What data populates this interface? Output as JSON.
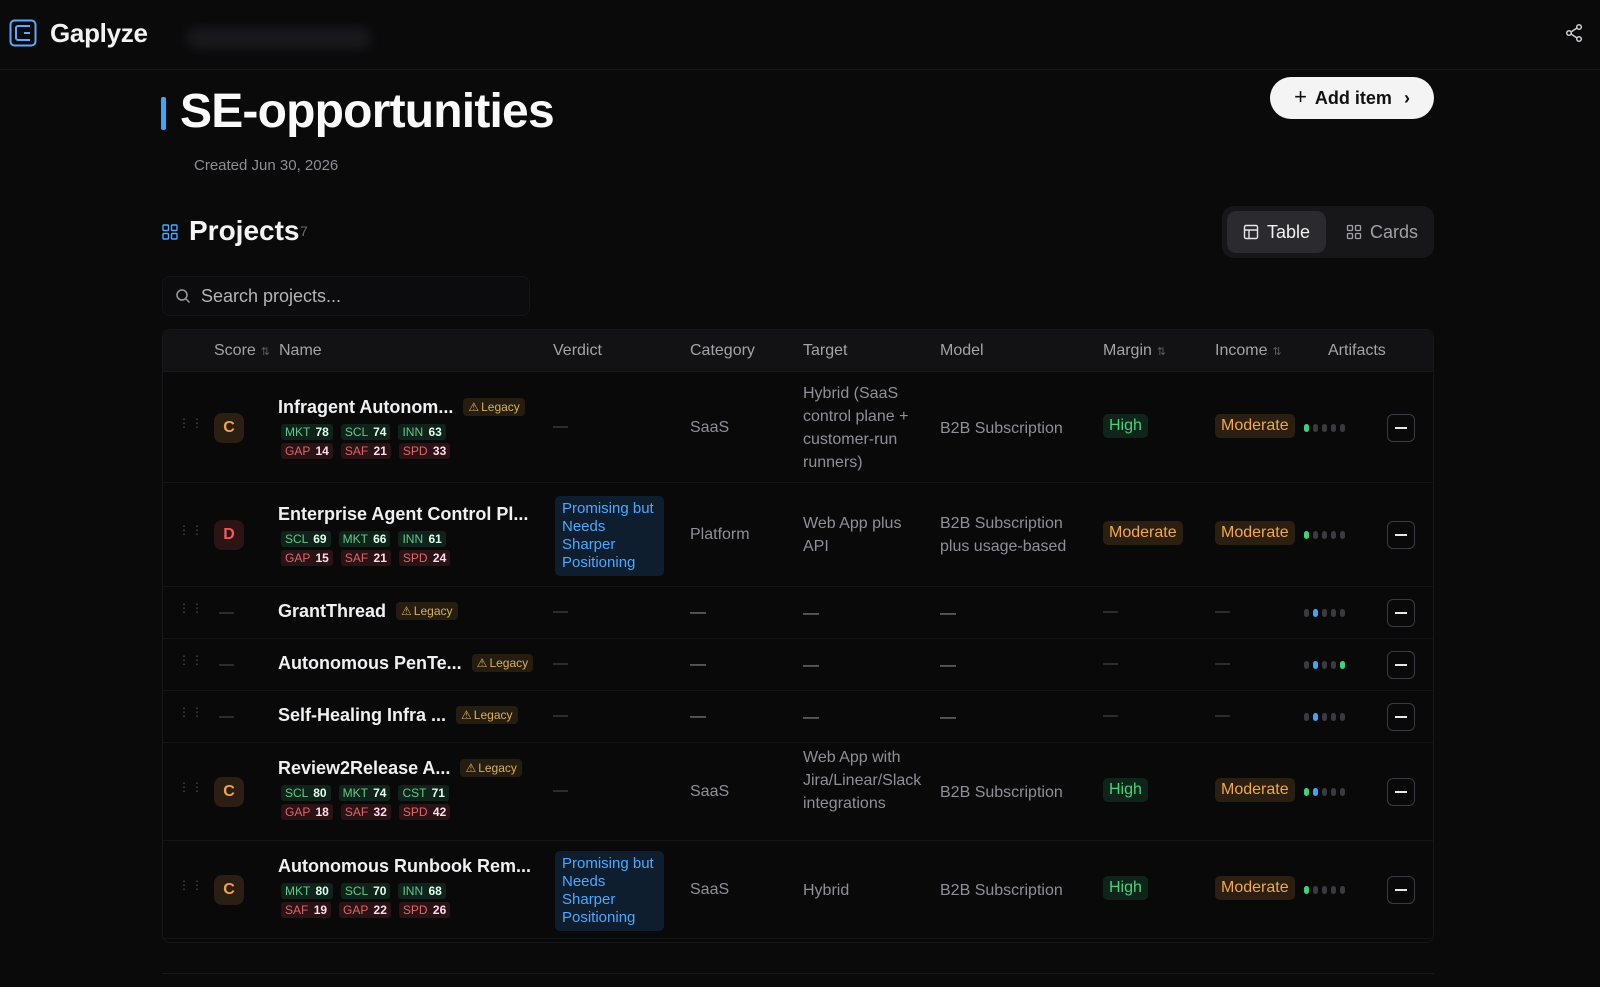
{
  "app": {
    "brand": "Gaplyze"
  },
  "header": {
    "title": "SE-opportunities",
    "created": "Created Jun 30, 2026",
    "add_button": "Add item"
  },
  "projects": {
    "title": "Projects",
    "count": "7",
    "view_table": "Table",
    "view_cards": "Cards",
    "search_placeholder": "Search projects..."
  },
  "columns": {
    "score": "Score",
    "name": "Name",
    "verdict": "Verdict",
    "category": "Category",
    "target": "Target",
    "model": "Model",
    "margin": "Margin",
    "income": "Income",
    "artifacts": "Artifacts"
  },
  "dash": "—",
  "legacy_label": "Legacy",
  "rows": [
    {
      "grade": "C",
      "name": "Infragent Autonom...",
      "legacy": true,
      "metrics_good": [
        [
          "MKT",
          "78"
        ],
        [
          "SCL",
          "74"
        ],
        [
          "INN",
          "63"
        ]
      ],
      "metrics_bad": [
        [
          "GAP",
          "14"
        ],
        [
          "SAF",
          "21"
        ],
        [
          "SPD",
          "33"
        ]
      ],
      "verdict": "—",
      "category": "SaaS",
      "target": "Hybrid (SaaS control plane + customer-run runners)",
      "model": "B2B Subscription",
      "margin": "High",
      "income": "Moderate",
      "artifacts": [
        "green",
        "off",
        "off",
        "off",
        "off"
      ]
    },
    {
      "grade": "D",
      "name": "Enterprise Agent Control Pl...",
      "legacy": false,
      "metrics_good": [
        [
          "SCL",
          "69"
        ],
        [
          "MKT",
          "66"
        ],
        [
          "INN",
          "61"
        ]
      ],
      "metrics_bad": [
        [
          "GAP",
          "15"
        ],
        [
          "SAF",
          "21"
        ],
        [
          "SPD",
          "24"
        ]
      ],
      "verdict": "Promising but Needs Sharper Positioning",
      "category": "Platform",
      "target": "Web App plus API",
      "model": "B2B Subscription plus usage-based",
      "margin": "Moderate",
      "income": "Moderate",
      "artifacts": [
        "green",
        "off",
        "off",
        "off",
        "off"
      ]
    },
    {
      "grade": "—",
      "name": "GrantThread",
      "legacy": true,
      "verdict": "—",
      "category": "—",
      "target": "—",
      "model": "—",
      "margin": "—",
      "income": "—",
      "artifacts": [
        "off",
        "blue",
        "off",
        "off",
        "off"
      ]
    },
    {
      "grade": "—",
      "name": "Autonomous PenTe...",
      "legacy": true,
      "verdict": "—",
      "category": "—",
      "target": "—",
      "model": "—",
      "margin": "—",
      "income": "—",
      "artifacts": [
        "off",
        "blue",
        "off",
        "off",
        "green"
      ]
    },
    {
      "grade": "—",
      "name": "Self-Healing Infra ...",
      "legacy": true,
      "verdict": "—",
      "category": "—",
      "target": "—",
      "model": "—",
      "margin": "—",
      "income": "—",
      "artifacts": [
        "off",
        "blue",
        "off",
        "off",
        "off"
      ]
    },
    {
      "grade": "C",
      "name": "Review2Release A...",
      "legacy": true,
      "metrics_good": [
        [
          "SCL",
          "80"
        ],
        [
          "MKT",
          "74"
        ],
        [
          "CST",
          "71"
        ]
      ],
      "metrics_bad": [
        [
          "GAP",
          "18"
        ],
        [
          "SAF",
          "32"
        ],
        [
          "SPD",
          "42"
        ]
      ],
      "verdict": "—",
      "category": "SaaS",
      "target": "Web App with Jira/Linear/Slack integrations",
      "model": "B2B Subscription",
      "margin": "High",
      "income": "Moderate",
      "artifacts": [
        "green",
        "blue",
        "off",
        "off",
        "off"
      ]
    },
    {
      "grade": "C",
      "name": "Autonomous Runbook Rem...",
      "legacy": false,
      "metrics_good": [
        [
          "MKT",
          "80"
        ],
        [
          "SCL",
          "70"
        ],
        [
          "INN",
          "68"
        ]
      ],
      "metrics_bad": [
        [
          "SAF",
          "19"
        ],
        [
          "GAP",
          "22"
        ],
        [
          "SPD",
          "26"
        ]
      ],
      "verdict": "Promising but Needs Sharper Positioning",
      "category": "SaaS",
      "target": "Hybrid",
      "model": "B2B Subscription",
      "margin": "High",
      "income": "Moderate",
      "artifacts": [
        "green",
        "off",
        "off",
        "off",
        "off"
      ]
    }
  ],
  "colors": {
    "accent": "#3ea6ff",
    "good": "#48d27c",
    "warn": "#f1a84a",
    "bad": "#ef5a5a"
  }
}
